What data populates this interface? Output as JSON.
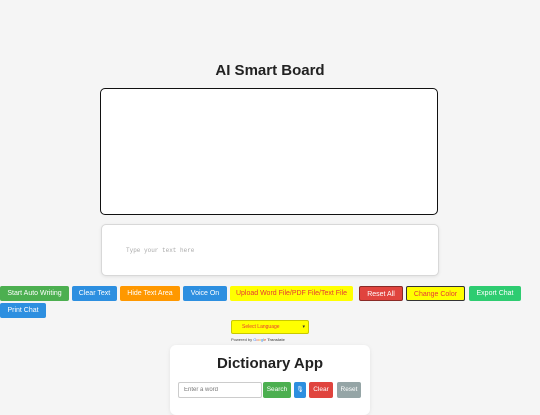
{
  "app": {
    "title": "AI Smart Board"
  },
  "text_area": {
    "placeholder": "Type your text here"
  },
  "toolbar": {
    "start_auto_writing": "Start Auto Writing",
    "clear_text": "Clear Text",
    "hide_text_area": "Hide Text Area",
    "voice_on": "Voice On",
    "upload_file": "Upload Word File/PDF File/Text File",
    "reset_all": "Reset All",
    "change_color": "Change Color",
    "export_chat": "Export Chat",
    "print_chat": "Print Chat"
  },
  "translate": {
    "select_label": "Select Language",
    "powered_by": "Powered by",
    "google": [
      "G",
      "o",
      "o",
      "g",
      "l",
      "e"
    ],
    "translate_word": "Translate"
  },
  "dictionary": {
    "title": "Dictionary App",
    "input_placeholder": "Enter a word",
    "search_label": "Search",
    "mic_glyph": "🎙",
    "clear_label": "Clear",
    "reset_label": "Reset"
  },
  "colors": {
    "green": "#4caf50",
    "blue": "#2d8fe0",
    "orange": "#ff9800",
    "yellow": "#ffff00",
    "red": "#e0443e",
    "grey": "#95a5a6"
  }
}
